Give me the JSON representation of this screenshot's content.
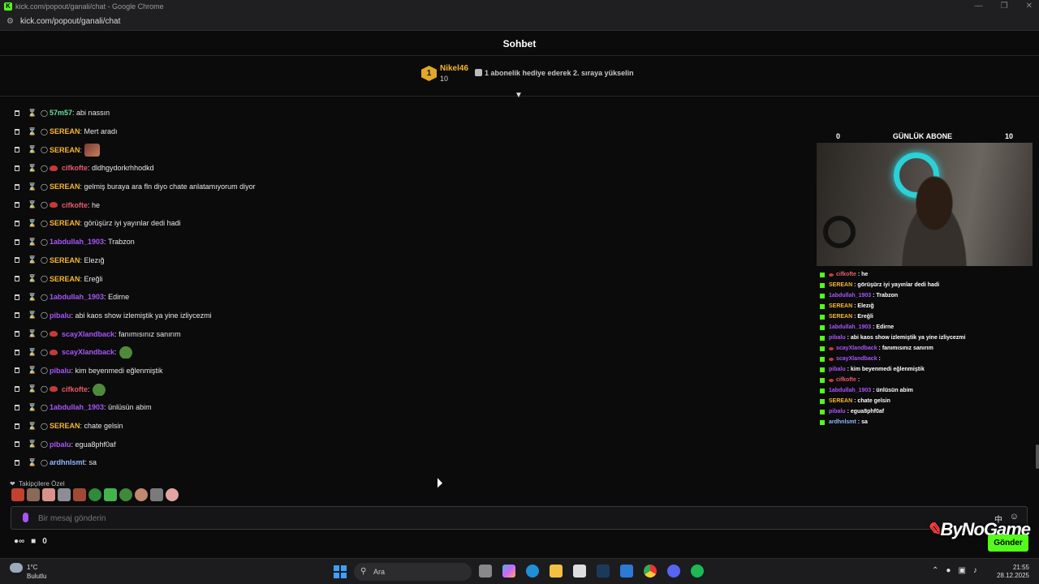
{
  "window": {
    "title": "kick.com/popout/ganali/chat - Google Chrome",
    "url": "kick.com/popout/ganali/chat"
  },
  "header": {
    "title": "Sohbet"
  },
  "pinned": {
    "rank": "1",
    "username": "Nikel46",
    "count": "10",
    "message": "1 abonelik hediye ederek 2. sıraya yükselin"
  },
  "colors": {
    "accent": "#53fc18",
    "serean": "#f7b731",
    "purple": "#a855f7",
    "red": "#e85a6b",
    "green": "#67e09b",
    "blue": "#8fb8ff"
  },
  "messages": [
    {
      "user": "57m57",
      "text": "abi nassın",
      "color": "#67e09b",
      "badge": false,
      "emote": ""
    },
    {
      "user": "SEREAN",
      "text": "Mert aradı",
      "color": "#f7b731",
      "badge": false,
      "emote": ""
    },
    {
      "user": "SEREAN",
      "text": "",
      "color": "#f7b731",
      "badge": false,
      "emote": "face"
    },
    {
      "user": "cifkofte",
      "text": "dldhgydorkrhhodkd",
      "color": "#e85a6b",
      "badge": true,
      "emote": ""
    },
    {
      "user": "SEREAN",
      "text": "gelmiş buraya ara fln diyo chate anlatamıyorum diyor",
      "color": "#f7b731",
      "badge": false,
      "emote": ""
    },
    {
      "user": "cifkofte",
      "text": "he",
      "color": "#e85a6b",
      "badge": true,
      "emote": ""
    },
    {
      "user": "SEREAN",
      "text": "görüşürz iyi yayınlar dedi hadi",
      "color": "#f7b731",
      "badge": false,
      "emote": ""
    },
    {
      "user": "1abdullah_1903",
      "text": "Trabzon",
      "color": "#a855f7",
      "badge": false,
      "emote": ""
    },
    {
      "user": "SEREAN",
      "text": "Elezığ",
      "color": "#f7b731",
      "badge": false,
      "emote": ""
    },
    {
      "user": "SEREAN",
      "text": "Ereğli",
      "color": "#f7b731",
      "badge": false,
      "emote": ""
    },
    {
      "user": "1abdullah_1903",
      "text": "Edirne",
      "color": "#a855f7",
      "badge": false,
      "emote": ""
    },
    {
      "user": "pibalu",
      "text": "abi kaos show izlemiştik ya yine izliycezmi",
      "color": "#a855f7",
      "badge": false,
      "emote": ""
    },
    {
      "user": "scayXlandback",
      "text": "fanımısınız sanırım",
      "color": "#a855f7",
      "badge": true,
      "emote": ""
    },
    {
      "user": "scayXlandback",
      "text": "",
      "color": "#a855f7",
      "badge": true,
      "emote": "frog"
    },
    {
      "user": "pibalu",
      "text": "kim beyenmedi eğlenmiştik",
      "color": "#a855f7",
      "badge": false,
      "emote": ""
    },
    {
      "user": "cifkofte",
      "text": "",
      "color": "#e85a6b",
      "badge": true,
      "emote": "frog"
    },
    {
      "user": "1abdullah_1903",
      "text": "ünlüsün abim",
      "color": "#a855f7",
      "badge": false,
      "emote": ""
    },
    {
      "user": "SEREAN",
      "text": "chate gelsin",
      "color": "#f7b731",
      "badge": false,
      "emote": ""
    },
    {
      "user": "pibalu",
      "text": "egua8phf0af",
      "color": "#a855f7",
      "badge": false,
      "emote": ""
    },
    {
      "user": "ardhnlsmt",
      "text": "sa",
      "color": "#8fb8ff",
      "badge": false,
      "emote": ""
    }
  ],
  "emote_section": {
    "label": "Takipçilere Özel"
  },
  "input": {
    "placeholder": "Bir mesaj gönderin"
  },
  "bottom": {
    "count": "0",
    "send_label": "Gönder"
  },
  "overlay": {
    "left_count": "0",
    "title": "GÜNLÜK ABONE",
    "right_count": "10",
    "mini_messages": [
      {
        "user": "cifkofte",
        "text": "he",
        "color": "#e85a6b",
        "badge": true
      },
      {
        "user": "SEREAN",
        "text": "görüşürz iyi yayınlar dedi hadi",
        "color": "#f7b731",
        "badge": false
      },
      {
        "user": "1abdullah_1903",
        "text": "Trabzon",
        "color": "#a855f7",
        "badge": false
      },
      {
        "user": "SEREAN",
        "text": "Elezığ",
        "color": "#f7b731",
        "badge": false
      },
      {
        "user": "SEREAN",
        "text": "Ereğli",
        "color": "#f7b731",
        "badge": false
      },
      {
        "user": "1abdullah_1903",
        "text": "Edirne",
        "color": "#a855f7",
        "badge": false
      },
      {
        "user": "pibalu",
        "text": "abi kaos show izlemiştik ya yine izliycezmi",
        "color": "#a855f7",
        "badge": false
      },
      {
        "user": "scayXlandback",
        "text": "fanımısınız sanırım",
        "color": "#a855f7",
        "badge": true
      },
      {
        "user": "scayXlandback",
        "text": "",
        "color": "#a855f7",
        "badge": true
      },
      {
        "user": "pibalu",
        "text": "kim beyenmedi eğlenmiştik",
        "color": "#a855f7",
        "badge": false
      },
      {
        "user": "cifkofte",
        "text": "",
        "color": "#e85a6b",
        "badge": true
      },
      {
        "user": "1abdullah_1903",
        "text": "ünlüsün abim",
        "color": "#a855f7",
        "badge": false
      },
      {
        "user": "SEREAN",
        "text": "chate gelsin",
        "color": "#f7b731",
        "badge": false
      },
      {
        "user": "pibalu",
        "text": "egua8phf0af",
        "color": "#a855f7",
        "badge": false
      },
      {
        "user": "ardhnlsmt",
        "text": "sa",
        "color": "#8fb8ff",
        "badge": false
      }
    ]
  },
  "watermark": {
    "text": "ByNoGame"
  },
  "taskbar": {
    "temperature": "1°C",
    "weather": "Bulutlu",
    "search_label": "Ara",
    "time": "21:55",
    "date": "28.12.2025"
  }
}
